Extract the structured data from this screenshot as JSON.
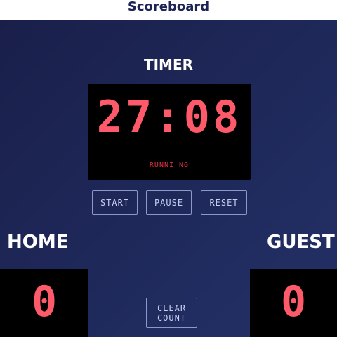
{
  "app": {
    "title": "Scoreboard"
  },
  "timer": {
    "heading": "TIMER",
    "display": "27:08",
    "status": "RUNNI NG"
  },
  "controls": {
    "start_label": "START",
    "pause_label": "PAUSE",
    "reset_label": "RESET",
    "clear_label": "CLEAR\nCOUNT"
  },
  "home": {
    "label": "HOME",
    "score": "0"
  },
  "guest": {
    "label": "GUEST",
    "score": "0"
  },
  "colors": {
    "digit_red": "#ff5a6a",
    "background_navy": "#1f2a5c",
    "button_border": "#8b98c9"
  }
}
